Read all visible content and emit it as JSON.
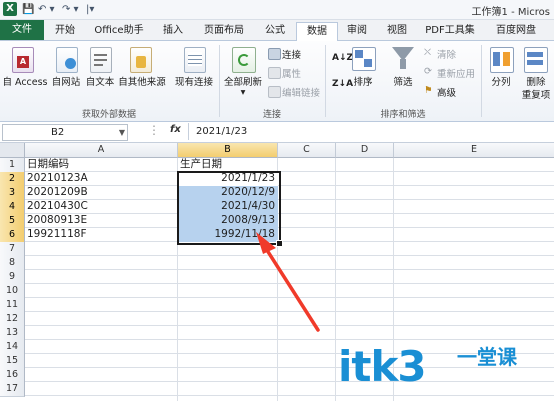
{
  "titlebar": {
    "title": "工作簿1 - Micros",
    "quick_access": [
      "💾",
      "↶ ▾",
      "↷ ▾",
      "|▾"
    ]
  },
  "tabs": [
    "文件",
    "开始",
    "Office助手",
    "插入",
    "页面布局",
    "公式",
    "数据",
    "审阅",
    "视图",
    "PDF工具集",
    "百度网盘"
  ],
  "active_tab": "数据",
  "ribbon": {
    "external": {
      "label": "获取外部数据",
      "buttons": [
        "自 Access",
        "自网站",
        "自文本",
        "自其他来源",
        "现有连接"
      ]
    },
    "connections": {
      "label": "连接",
      "refresh": "全部刷新",
      "items": [
        "连接",
        "属性",
        "编辑链接"
      ]
    },
    "sort_filter": {
      "label": "排序和筛选",
      "sort": "排序",
      "filter": "筛选",
      "items": [
        "清除",
        "重新应用",
        "高级"
      ]
    },
    "tools": {
      "split": "分列",
      "remove": "删除",
      "remove2": "重复项"
    }
  },
  "formula_bar": {
    "name_box": "B2",
    "fx": "fx",
    "formula": "2021/1/23"
  },
  "columns": [
    "A",
    "B",
    "C",
    "D",
    "E"
  ],
  "selected_column": "B",
  "rows": [
    "1",
    "2",
    "3",
    "4",
    "5",
    "6",
    "7",
    "8",
    "9",
    "10",
    "11",
    "12",
    "13",
    "14",
    "15",
    "16",
    "17"
  ],
  "selected_rows": [
    "2",
    "3",
    "4",
    "5",
    "6"
  ],
  "cells": {
    "A": [
      "日期编码",
      "20210123A",
      "20201209B",
      "20210430C",
      "20080913E",
      "19921118F"
    ],
    "B": [
      "生产日期",
      "2021/1/23",
      "2020/12/9",
      "2021/4/30",
      "2008/9/13",
      "1992/11/18"
    ]
  },
  "colors": {
    "accent": "#1f7246",
    "selection": "#b7d2ee",
    "arrow": "#f03a2a",
    "watermark": "#1a8fd4"
  },
  "watermark": {
    "main": "itk3",
    "sub": "一堂课"
  }
}
